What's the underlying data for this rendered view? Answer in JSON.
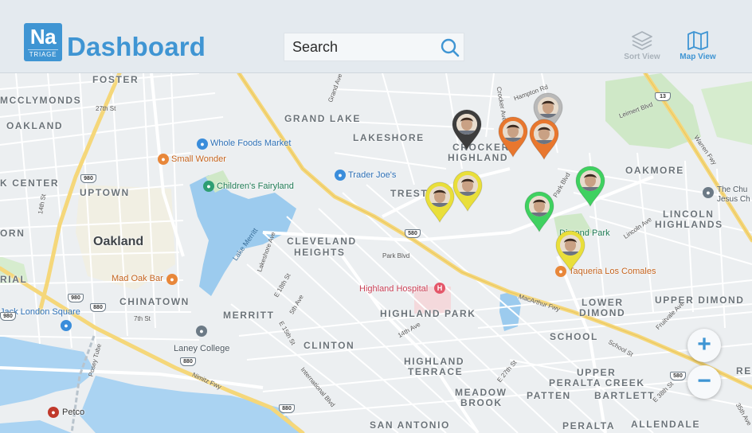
{
  "header": {
    "logo": {
      "line1": "Na",
      "line2": "TRIAGE"
    },
    "title": "Dashboard",
    "search": {
      "placeholder": "Search"
    },
    "views": {
      "sort_label": "Sort View",
      "map_label": "Map View",
      "active": "map"
    },
    "brand_color": "#3f95d3"
  },
  "map": {
    "areas": [
      "FOSTER",
      "MCCLYMONDS",
      "OAKLAND",
      "K CENTER",
      "UPTOWN",
      "ORN",
      "RIAL",
      "CHINATOWN",
      "GRAND LAKE",
      "LAKESHORE",
      "CROCKER",
      "HIGHLAND",
      "TREST",
      "CLEVELAND",
      "HEIGHTS",
      "MERRITT",
      "CLINTON",
      "HIGHLAND PARK",
      "HIGHLAND",
      "TERRACE",
      "MEADOW",
      "BROOK",
      "SAN ANTONIO",
      "OAKMORE",
      "LINCOLN",
      "HIGHLANDS",
      "LOWER",
      "DIMOND",
      "UPPER DIMOND",
      "SCHOOL",
      "UPPER",
      "PERALTA CREEK",
      "PATTEN",
      "BARTLETT",
      "PERALTA",
      "ALLENDALE",
      "RE"
    ],
    "city": "Oakland",
    "streets": [
      "27th St",
      "14th St",
      "7th St",
      "E 18th St",
      "5th Ave",
      "E 15th St",
      "14th Ave",
      "International Blvd",
      "E 27th St",
      "School St",
      "Park Blvd",
      "Lakeshore Ave",
      "Grand Ave",
      "Crocker Ave",
      "Hampton Rd",
      "Park Blvd",
      "Leimert Blvd",
      "Lincoln Ave",
      "Fruitvale Ave",
      "Posey Tube",
      "Nimitz Fwy",
      "MacArthur Fwy",
      "Warren Fwy",
      "E 38th St",
      "35th Ave"
    ],
    "water": [
      "Lake Merritt"
    ],
    "pois": [
      {
        "name": "Whole Foods Market",
        "icon": "shopping-cart-icon",
        "color": "#3a8ddb"
      },
      {
        "name": "Small Wonder",
        "icon": "fork-knife-icon",
        "color": "#e8873a"
      },
      {
        "name": "Children's Fairyland",
        "icon": "park-icon",
        "color": "#2e9e73"
      },
      {
        "name": "Trader Joe's",
        "icon": "shopping-cart-icon",
        "color": "#3a8ddb"
      },
      {
        "name": "Mad Oak Bar",
        "icon": "fork-knife-icon",
        "color": "#e8873a"
      },
      {
        "name": "Jack London Square",
        "icon": "shopping-bag-icon",
        "color": "#3a8ddb"
      },
      {
        "name": "Laney College",
        "icon": "school-icon",
        "color": "#6c7a86"
      },
      {
        "name": "Highland Hospital",
        "icon": "hospital-icon",
        "color": "#e4576a"
      },
      {
        "name": "Dimond Park",
        "icon": "park-icon",
        "color": "#2e9e73"
      },
      {
        "name": "Taqueria Los Comales",
        "icon": "fork-knife-icon",
        "color": "#e8873a"
      },
      {
        "name": "The Chu Jesus Ch",
        "icon": "church-icon",
        "color": "#6c7a86"
      },
      {
        "name": "Petco",
        "icon": "store-icon",
        "color": "#c0392b"
      }
    ],
    "highways": [
      "980",
      "980",
      "580",
      "980",
      "880",
      "880",
      "880",
      "13",
      "580"
    ],
    "pins": [
      {
        "status": "dark",
        "color": "#3d3d3d"
      },
      {
        "status": "inactive",
        "color": "#b9b9b9"
      },
      {
        "status": "orange",
        "color": "#e8772e"
      },
      {
        "status": "orange",
        "color": "#e8772e"
      },
      {
        "status": "yellow",
        "color": "#e9df3a"
      },
      {
        "status": "yellow",
        "color": "#e9df3a"
      },
      {
        "status": "green",
        "color": "#3fd160"
      },
      {
        "status": "green",
        "color": "#3fd160"
      },
      {
        "status": "yellow",
        "color": "#e9df3a"
      }
    ],
    "controls": {
      "zoom_in": "+",
      "zoom_out": "−"
    }
  }
}
